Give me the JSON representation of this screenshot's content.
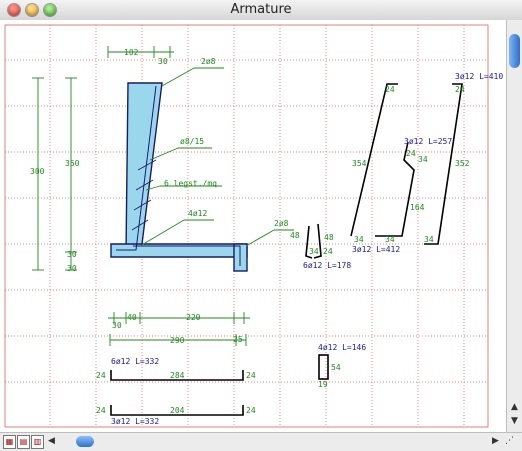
{
  "window": {
    "title": "Armature"
  },
  "colors": {
    "grid": "#e06060",
    "dim": "#1f8a1f",
    "bar": "#000000",
    "label": "#1a1aa0",
    "section": "#9ad7ec"
  },
  "labels": {
    "d102": "102",
    "d30a": "30",
    "d2o8a": "2ø8",
    "d300": "300",
    "d350": "350",
    "dphi815": "ø8/15",
    "d6legst": "6 legst./mq",
    "d4o12": "4ø12",
    "d2o8b": "2ø8",
    "d30b": "30",
    "d30c": "30",
    "d48a": "48",
    "d48b": "48",
    "d34a": "34",
    "d24a": "24",
    "d6o12": "6ø12 L=178",
    "d354": "354",
    "d24b": "24",
    "d34b": "34",
    "d3o12a": "3ø12 L=412",
    "d34c": "34",
    "d24c": "24",
    "d34d": "34",
    "d164": "164",
    "d3o12b": "3ø12 L=257",
    "d3o12c": "3ø12 L=410",
    "d24d": "24",
    "d352": "352",
    "d34e": "34",
    "d40": "40",
    "d30e": "30",
    "d220": "220",
    "d290": "290",
    "d25": "25",
    "top_label": "6ø12 L=332",
    "top_left": "24",
    "top_mid": "284",
    "top_right": "24",
    "bot_left": "24",
    "bot_mid": "204",
    "bot_right": "24",
    "bot_label": "3ø12 L=332",
    "s_label": "4ø12 L=146",
    "s_right": "54",
    "s_bottom": "19"
  }
}
